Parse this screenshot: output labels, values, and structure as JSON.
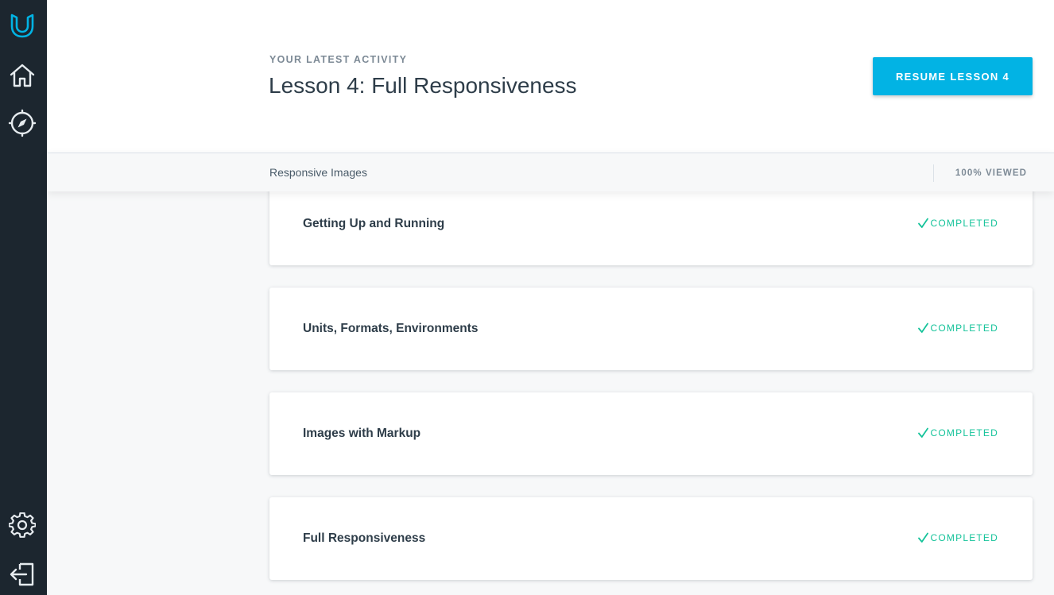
{
  "colors": {
    "sidebar": "#1c262f",
    "accent": "#02b3e4",
    "completed": "#15c39a"
  },
  "sidebar": {
    "icons": [
      "udacity-logo-icon",
      "home-icon",
      "compass-icon",
      "gear-icon",
      "logout-icon"
    ]
  },
  "header": {
    "eyebrow": "YOUR LATEST ACTIVITY",
    "title": "Lesson 4: Full Responsiveness",
    "resume_label": "RESUME LESSON 4"
  },
  "section": {
    "title": "Responsive Images",
    "status": "100% VIEWED"
  },
  "lessons": [
    {
      "title": "Getting Up and Running",
      "status": "COMPLETED"
    },
    {
      "title": "Units, Formats, Environments",
      "status": "COMPLETED"
    },
    {
      "title": "Images with Markup",
      "status": "COMPLETED"
    },
    {
      "title": "Full Responsiveness",
      "status": "COMPLETED"
    }
  ]
}
